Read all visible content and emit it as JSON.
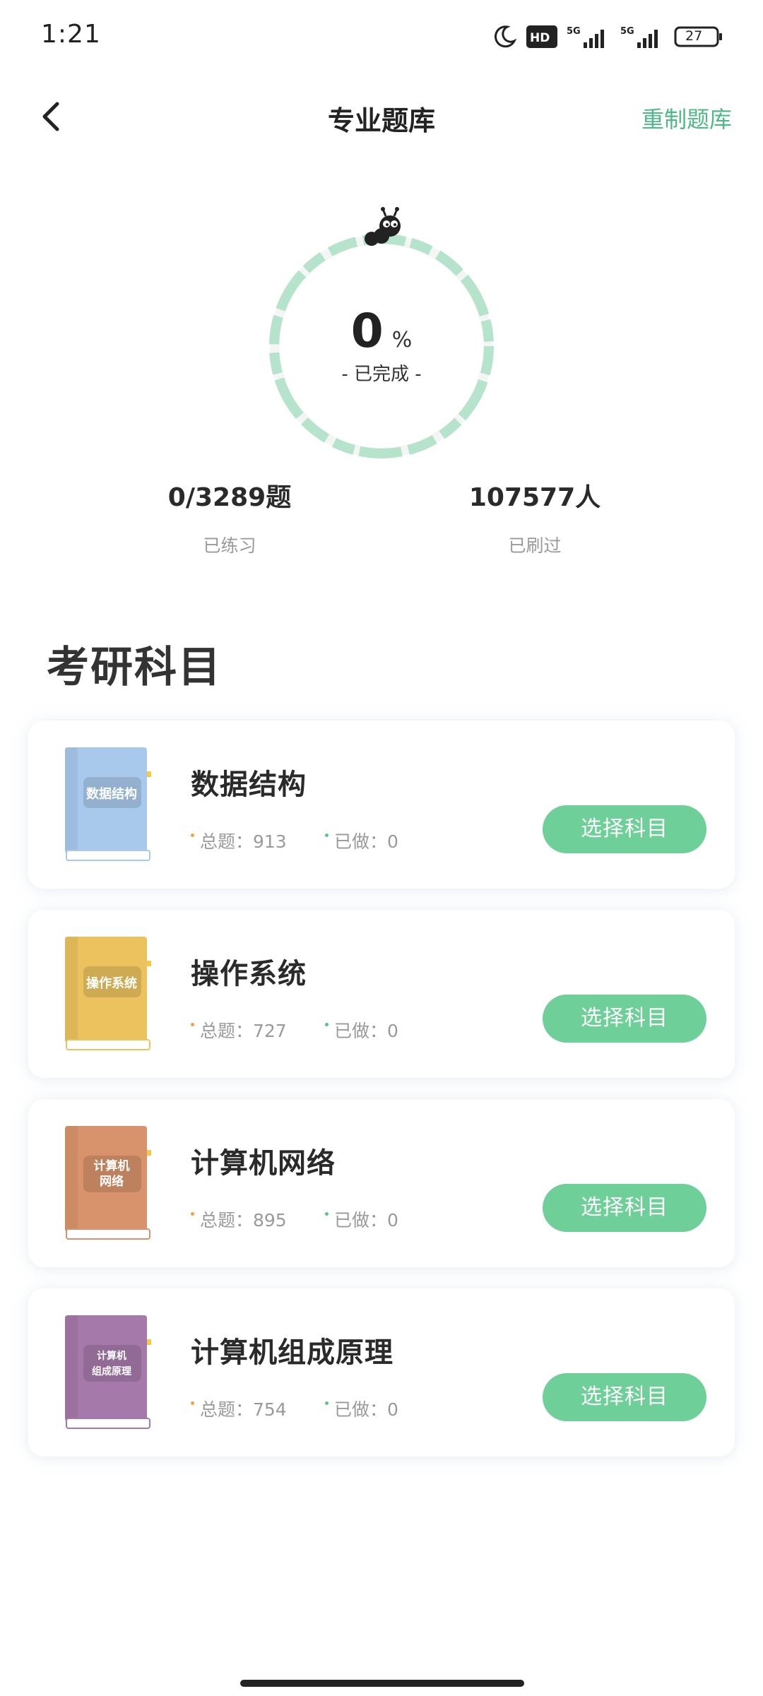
{
  "status_bar": {
    "time": "1:21",
    "battery": "27",
    "icons": [
      "moon-icon",
      "hd-icon",
      "signal-5g-icon",
      "signal-5g-icon",
      "battery-icon"
    ]
  },
  "nav": {
    "title": "专业题库",
    "reset_label": "重制题库"
  },
  "progress": {
    "value": "0",
    "unit": "%",
    "label": "- 已完成 -",
    "fraction": 0
  },
  "stats": [
    {
      "value": "0/3289题",
      "label": "已练习"
    },
    {
      "value": "107577人",
      "label": "已刷过"
    }
  ],
  "section_title": "考研科目",
  "subjects": [
    {
      "name": "数据结构",
      "book_label": "数据结构",
      "book_color": "#a8c9ec",
      "total_label": "总题：913",
      "done_label": "已做：0",
      "button_label": "选择科目"
    },
    {
      "name": "操作系统",
      "book_label": "操作系统",
      "book_color": "#ebc25e",
      "total_label": "总题：727",
      "done_label": "已做：0",
      "button_label": "选择科目"
    },
    {
      "name": "计算机网络",
      "book_label": "计算机网络",
      "book_color": "#d9936c",
      "total_label": "总题：895",
      "done_label": "已做：0",
      "button_label": "选择科目"
    },
    {
      "name": "计算机组成原理",
      "book_label": "计算机组成原理",
      "book_color": "#a679ab",
      "total_label": "总题：754",
      "done_label": "已做：0",
      "button_label": "选择科目"
    }
  ],
  "colors": {
    "accent": "#4fb887",
    "button": "#6ecf98",
    "ring": "#b5e3cc",
    "total_dot": "#f0a040",
    "done_dot": "#5cc48a"
  }
}
